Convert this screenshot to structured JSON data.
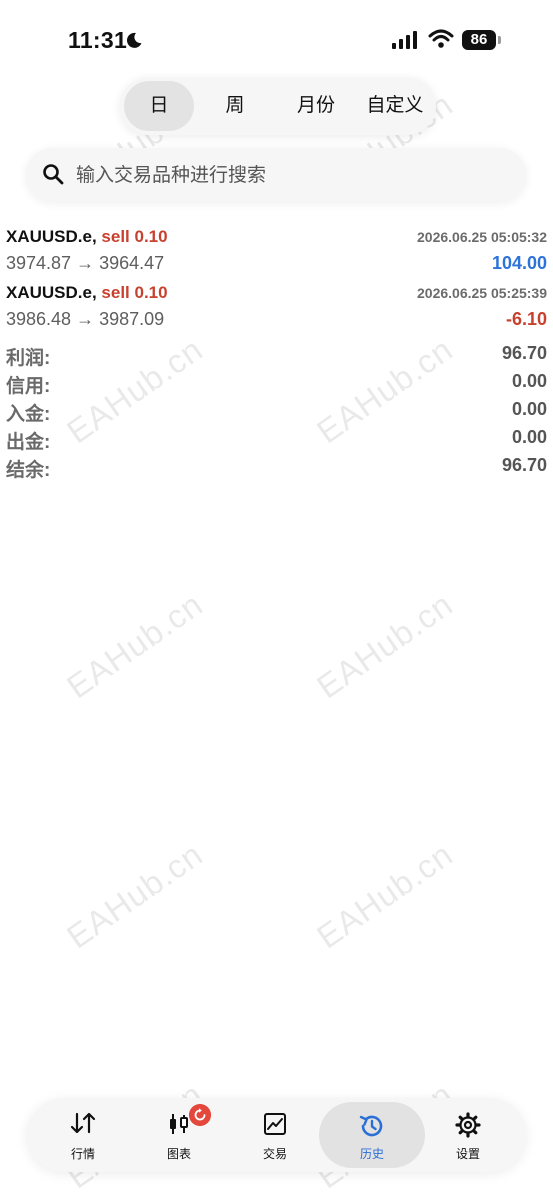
{
  "status_bar": {
    "time": "11:31",
    "battery": "86"
  },
  "period_tabs": [
    {
      "label": "日",
      "active": true
    },
    {
      "label": "周",
      "active": false
    },
    {
      "label": "月份",
      "active": false
    },
    {
      "label": "自定义",
      "active": false
    }
  ],
  "search": {
    "placeholder": "输入交易品种进行搜索"
  },
  "deals": [
    {
      "symbol": "XAUUSD.e,",
      "side": "sell 0.10",
      "time": "2026.06.25 05:05:32",
      "prices": "3974.87 → 3964.47",
      "profit": "104.00",
      "profit_color": "#2d73d9"
    },
    {
      "symbol": "XAUUSD.e,",
      "side": "sell 0.10",
      "time": "2026.06.25 05:25:39",
      "prices": "3986.48 → 3987.09",
      "profit": "-6.10",
      "profit_color": "#c8412f"
    }
  ],
  "summary": [
    {
      "label": "利润:",
      "value": "96.70"
    },
    {
      "label": "信用:",
      "value": "0.00"
    },
    {
      "label": "入金:",
      "value": "0.00"
    },
    {
      "label": "出金:",
      "value": "0.00"
    },
    {
      "label": "结余:",
      "value": "96.70"
    }
  ],
  "watermark": "EAHub.cn",
  "tab_bar": [
    {
      "label": "行情",
      "icon": "sort-arrows-icon",
      "active": false
    },
    {
      "label": "图表",
      "icon": "candlestick-icon",
      "active": false
    },
    {
      "label": "交易",
      "icon": "line-chart-icon",
      "active": false
    },
    {
      "label": "历史",
      "icon": "history-clock-icon",
      "active": true
    },
    {
      "label": "设置",
      "icon": "gear-icon",
      "active": false
    }
  ],
  "colors": {
    "accent": "#2b6fd6",
    "sell": "#c8412f",
    "badge": "#e4483d"
  }
}
